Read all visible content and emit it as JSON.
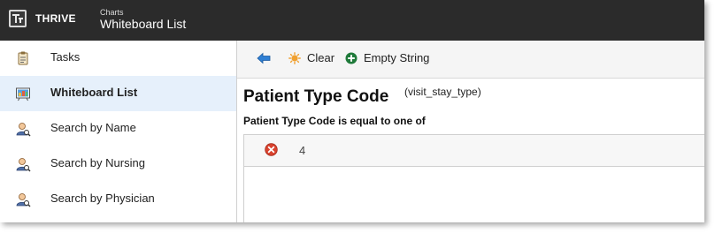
{
  "header": {
    "brand": "THRIVE",
    "section": "Charts",
    "title": "Whiteboard List"
  },
  "sidebar": {
    "items": [
      {
        "label": "Tasks",
        "icon": "clipboard-icon",
        "active": false
      },
      {
        "label": "Whiteboard List",
        "icon": "whiteboard-icon",
        "active": true
      },
      {
        "label": "Search by Name",
        "icon": "person-search-icon",
        "active": false
      },
      {
        "label": "Search by Nursing",
        "icon": "person-search-icon",
        "active": false
      },
      {
        "label": "Search by Physician",
        "icon": "person-search-icon",
        "active": false
      }
    ]
  },
  "toolbar": {
    "back_icon": "back-arrow-icon",
    "clear_label": "Clear",
    "empty_string_label": "Empty String"
  },
  "filter": {
    "field_title": "Patient Type Code",
    "field_code": "(visit_stay_type)",
    "condition": "Patient Type Code is equal to one of",
    "values": [
      "4"
    ]
  },
  "colors": {
    "topbar": "#2b2b2b",
    "active_item": "#e6f0fb",
    "back_arrow": "#2f7fd4",
    "clear_icon": "#f0a030",
    "empty_icon": "#1f7a3a",
    "remove_icon": "#d9432f"
  }
}
